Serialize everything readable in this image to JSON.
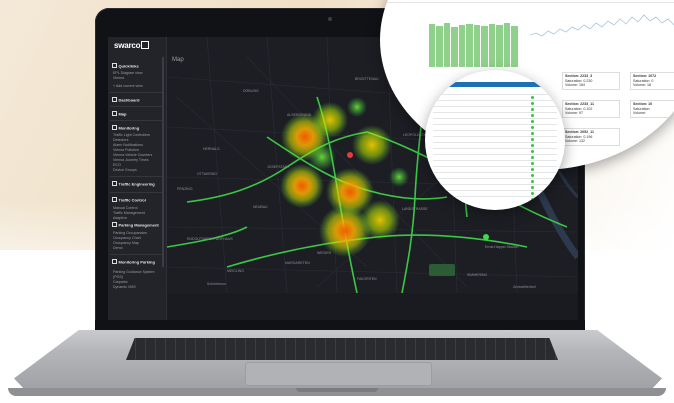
{
  "app": {
    "brand": "swarco"
  },
  "sidebar": {
    "sections": [
      {
        "label": "Quicklinks",
        "items": [
          "EPL Diagram view",
          "Vienna",
          "+ Add current view"
        ]
      },
      {
        "label": "Dashboard",
        "items": []
      },
      {
        "label": "Map",
        "items": []
      },
      {
        "label": "Monitoring",
        "items": [
          "Traffic Light Controllers",
          "Detectors",
          "Alarm Notifications",
          "Vienna Pollution",
          "Vienna Vehicle Counters",
          "Vienna Journey Times",
          "ECO",
          "Device Groups"
        ]
      },
      {
        "label": "Traffic Engineering",
        "items": []
      },
      {
        "label": "Traffic Control",
        "items": [
          "Manual Control",
          "Traffic Management",
          "Adaptive"
        ]
      },
      {
        "label": "Parking Management",
        "items": [
          "Parking Occupancies",
          "Occupancy Chart",
          "Occupancy Map",
          "Demo"
        ]
      },
      {
        "label": "Monitoring Parking",
        "items": [
          "Parking Guidance System",
          "(PGS)",
          "Carparks",
          "Dynamic VMS"
        ]
      }
    ]
  },
  "map": {
    "title": "Map",
    "labels": [
      "DÖBLING",
      "BRIGITTENAU",
      "LEOPOLDSTADT",
      "ALSERGRUND",
      "JOSEFSTADT",
      "NEUBAU",
      "WIEDEN",
      "MARGARETEN",
      "LANDSTRASSE",
      "FAVORITEN",
      "SIMMERING",
      "MEIDLING",
      "HERNALS",
      "PENZING",
      "OTTAKRING",
      "RUDOLFSHEIM-FÜNFHAUS",
      "Ernst-Happel-Stadion",
      "Zentralfriedhof",
      "Schönbrunn"
    ],
    "colors": {
      "heat_hot": "#ff6a00",
      "heat_mid": "#ffd000",
      "heat_cool": "#5be33c",
      "road": "#3fd94a"
    }
  },
  "zoom_panel": {
    "cards": [
      {
        "section": "Section: 2233_3",
        "saturation": "Saturation: 0.230",
        "volume": "Volume: 184"
      },
      {
        "section": "Section: 2233_11",
        "saturation": "Saturation: 0.102",
        "volume": "Volume: 97"
      },
      {
        "section": "Section: 2052_11",
        "saturation": "Saturation: 0.196",
        "volume": "Volume: 132"
      },
      {
        "section": "Section: 2029_3",
        "saturation": "Saturation: 0.213",
        "volume": "Volume: 135"
      }
    ],
    "right_cards": [
      {
        "section": "Section: 1072",
        "saturation": "Saturation: 0",
        "volume": "Volume: 18"
      },
      {
        "section": "Section: 10",
        "saturation": "Saturation:",
        "volume": "Volume:"
      }
    ]
  },
  "bar_chart": {
    "values": [
      0.95,
      0.92,
      0.97,
      0.9,
      0.93,
      0.96,
      0.94,
      0.91,
      0.95,
      0.93,
      0.97,
      0.92
    ],
    "color": "#8fd18a"
  }
}
